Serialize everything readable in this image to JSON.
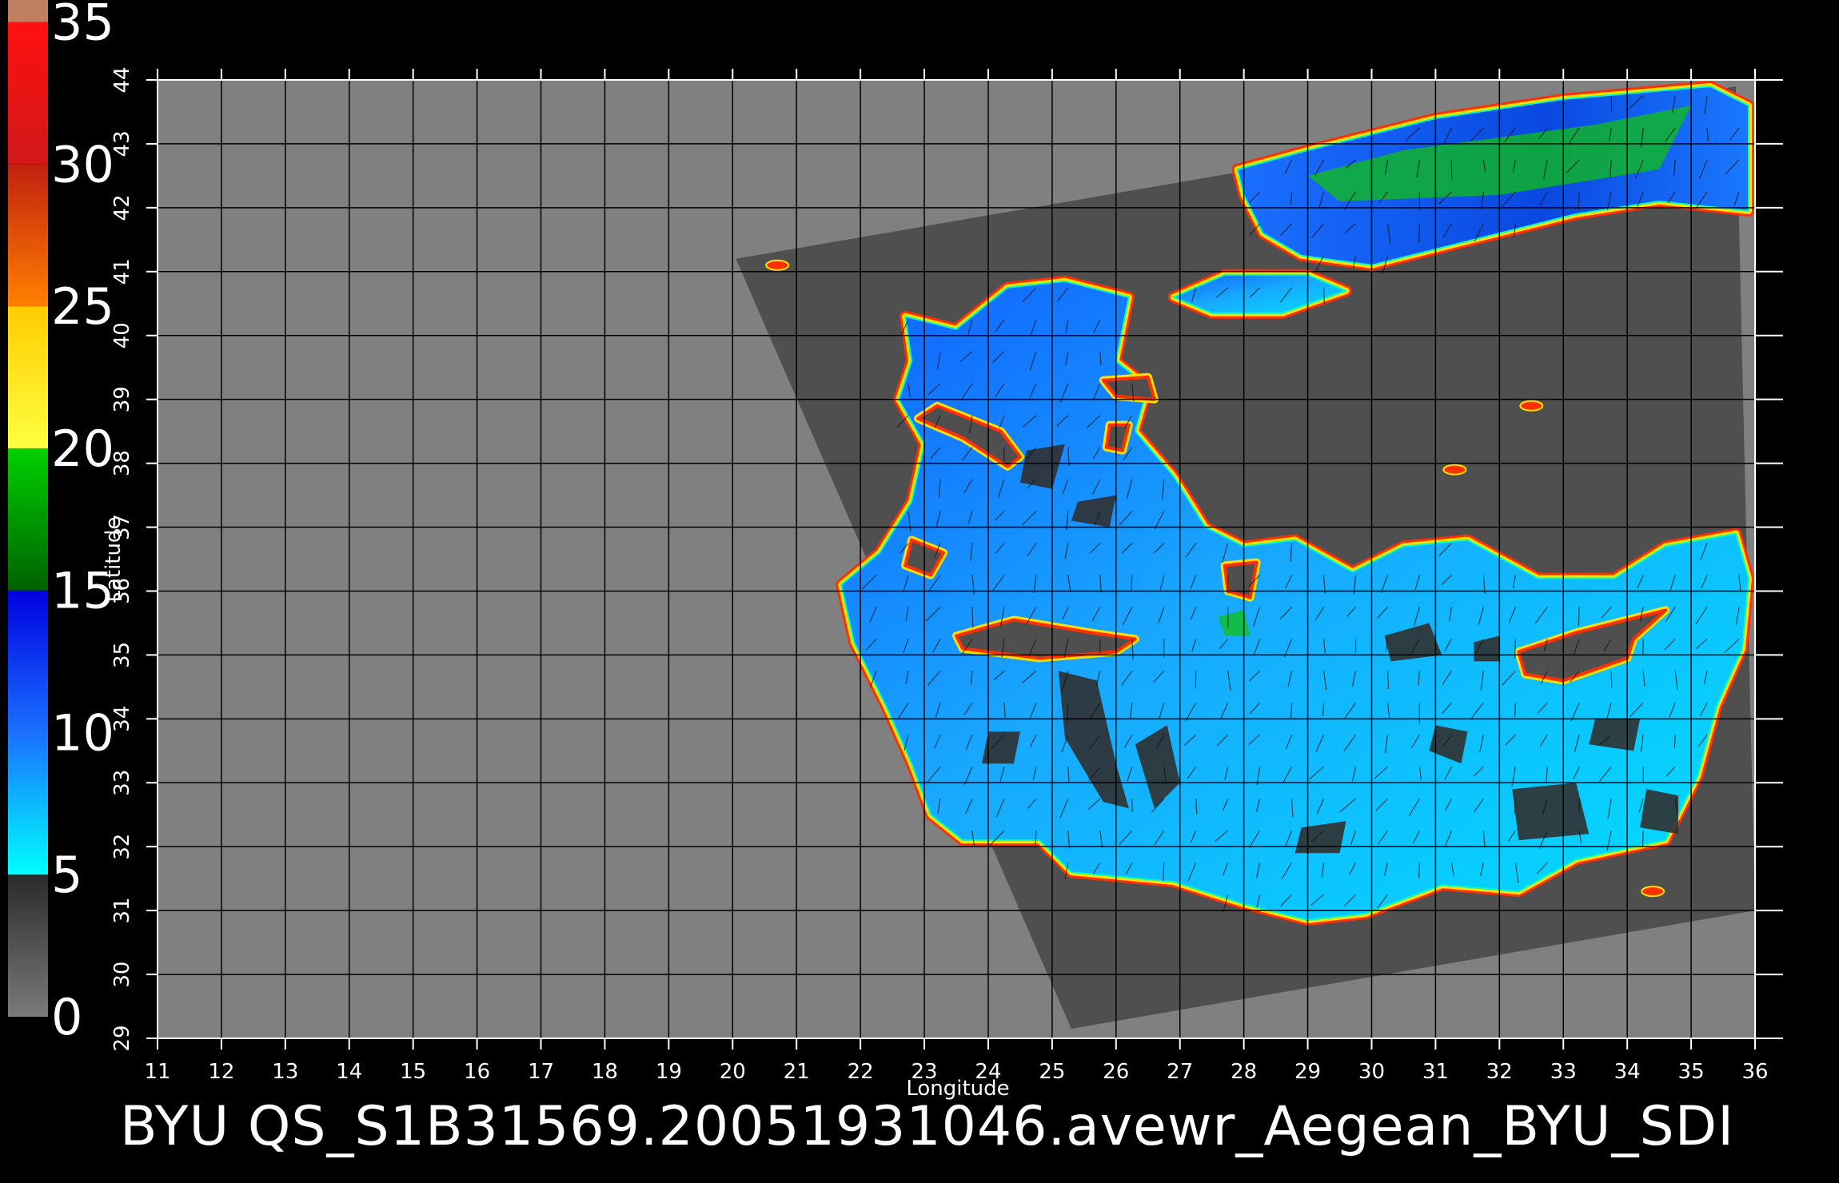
{
  "footer_caption": "BYU  QS_S1B31569.20051931046.avewr_Aegean_BYU_SDI",
  "colorbar": {
    "labels": [
      "0",
      "5",
      "10",
      "15",
      "20",
      "25",
      "30",
      "35"
    ],
    "segments": [
      {
        "from": 0,
        "to": 5,
        "color_top": "#2a2a2a",
        "color_bottom": "#7a7a7a"
      },
      {
        "from": 5,
        "to": 10,
        "color_top": "#1a70ff",
        "color_bottom": "#00ffff"
      },
      {
        "from": 10,
        "to": 15,
        "color_top": "#0000e0",
        "color_bottom": "#1a70ff"
      },
      {
        "from": 15,
        "to": 20,
        "color_top": "#00d000",
        "color_bottom": "#006000"
      },
      {
        "from": 20,
        "to": 25,
        "color_top": "#ffcc00",
        "color_bottom": "#ffff40"
      },
      {
        "from": 25,
        "to": 30,
        "color_top": "#c02010",
        "color_bottom": "#ff8000"
      },
      {
        "from": 30,
        "to": 35,
        "color_top": "#ff1010",
        "color_bottom": "#d01818"
      },
      {
        "from": 35,
        "to": 36,
        "color_top": "#c08060",
        "color_bottom": "#c08060"
      }
    ]
  },
  "map": {
    "x_axis_title": "Longitude",
    "y_axis_title": "Latitude",
    "lon_range": [
      11,
      36
    ],
    "lat_range": [
      29,
      44
    ],
    "lon_ticks": [
      "11",
      "12",
      "13",
      "14",
      "15",
      "16",
      "17",
      "18",
      "19",
      "20",
      "21",
      "22",
      "23",
      "24",
      "25",
      "26",
      "27",
      "28",
      "29",
      "30",
      "31",
      "32",
      "33",
      "34",
      "35",
      "36"
    ],
    "lat_ticks": [
      "29",
      "30",
      "31",
      "32",
      "33",
      "34",
      "35",
      "36",
      "37",
      "38",
      "39",
      "40",
      "41",
      "42",
      "43",
      "44"
    ],
    "colors": {
      "background": "#808080",
      "swath": "#4f4f4f",
      "grid": "#000000",
      "ocean_low": "#00e8ff",
      "ocean_mid": "#1a90ff",
      "ocean_high": "#0a40e8",
      "coast_edge": "#ff3000",
      "coast_yellow": "#ffe000",
      "calm_patch": "#303030",
      "strong_wind": "#10c010"
    },
    "swath_polygon_lonlat": [
      [
        20.05,
        41.2
      ],
      [
        35.7,
        43.9
      ],
      [
        36.0,
        31.0
      ],
      [
        25.3,
        29.15
      ]
    ],
    "water_regions_lonlat": [
      {
        "name": "black-sea",
        "points": [
          [
            27.9,
            42.6
          ],
          [
            29.0,
            42.9
          ],
          [
            31.0,
            43.4
          ],
          [
            33.0,
            43.7
          ],
          [
            35.3,
            43.9
          ],
          [
            35.9,
            43.6
          ],
          [
            35.9,
            41.95
          ],
          [
            34.5,
            42.1
          ],
          [
            33.2,
            41.9
          ],
          [
            31.6,
            41.5
          ],
          [
            30.0,
            41.1
          ],
          [
            28.9,
            41.25
          ],
          [
            28.3,
            41.6
          ],
          [
            28.0,
            42.2
          ]
        ],
        "strong": true
      },
      {
        "name": "sea-of-marmara",
        "points": [
          [
            26.9,
            40.6
          ],
          [
            27.7,
            40.95
          ],
          [
            29.0,
            40.95
          ],
          [
            29.6,
            40.7
          ],
          [
            28.6,
            40.35
          ],
          [
            27.5,
            40.35
          ]
        ],
        "strong": false
      },
      {
        "name": "aegean-mediterranean",
        "points": [
          [
            22.7,
            40.3
          ],
          [
            23.5,
            40.1
          ],
          [
            24.3,
            40.75
          ],
          [
            25.2,
            40.85
          ],
          [
            26.2,
            40.6
          ],
          [
            26.0,
            39.6
          ],
          [
            26.5,
            39.2
          ],
          [
            26.3,
            38.5
          ],
          [
            26.9,
            37.8
          ],
          [
            27.4,
            37.0
          ],
          [
            28.0,
            36.7
          ],
          [
            28.8,
            36.8
          ],
          [
            29.7,
            36.3
          ],
          [
            30.5,
            36.7
          ],
          [
            31.5,
            36.8
          ],
          [
            32.6,
            36.2
          ],
          [
            33.8,
            36.2
          ],
          [
            34.6,
            36.7
          ],
          [
            35.7,
            36.9
          ],
          [
            35.9,
            36.2
          ],
          [
            35.8,
            35.1
          ],
          [
            35.4,
            34.2
          ],
          [
            35.1,
            33.1
          ],
          [
            34.6,
            32.1
          ],
          [
            33.2,
            31.8
          ],
          [
            32.3,
            31.3
          ],
          [
            31.1,
            31.4
          ],
          [
            29.9,
            30.95
          ],
          [
            29.0,
            30.85
          ],
          [
            28.0,
            31.1
          ],
          [
            26.9,
            31.45
          ],
          [
            25.3,
            31.6
          ],
          [
            24.8,
            32.1
          ],
          [
            23.6,
            32.1
          ],
          [
            23.1,
            32.5
          ],
          [
            22.8,
            33.3
          ],
          [
            22.4,
            34.2
          ],
          [
            21.9,
            35.2
          ],
          [
            21.7,
            36.1
          ],
          [
            22.3,
            36.6
          ],
          [
            22.8,
            37.4
          ],
          [
            23.0,
            38.3
          ],
          [
            22.6,
            39.0
          ],
          [
            22.8,
            39.6
          ]
        ],
        "strong": false
      }
    ],
    "land_islands_lonlat": [
      {
        "name": "crete",
        "points": [
          [
            23.5,
            35.3
          ],
          [
            24.4,
            35.55
          ],
          [
            25.6,
            35.35
          ],
          [
            26.3,
            35.25
          ],
          [
            26.0,
            35.05
          ],
          [
            24.8,
            34.95
          ],
          [
            23.6,
            35.1
          ]
        ]
      },
      {
        "name": "cyprus",
        "points": [
          [
            32.3,
            35.05
          ],
          [
            33.2,
            35.35
          ],
          [
            34.6,
            35.7
          ],
          [
            34.1,
            35.25
          ],
          [
            34.0,
            34.95
          ],
          [
            33.0,
            34.6
          ],
          [
            32.4,
            34.7
          ]
        ]
      },
      {
        "name": "euboea",
        "points": [
          [
            23.2,
            38.9
          ],
          [
            24.2,
            38.5
          ],
          [
            24.5,
            38.1
          ],
          [
            24.3,
            37.95
          ],
          [
            23.6,
            38.4
          ],
          [
            22.9,
            38.7
          ]
        ]
      },
      {
        "name": "lesbos",
        "points": [
          [
            25.8,
            39.3
          ],
          [
            26.5,
            39.35
          ],
          [
            26.6,
            39.0
          ],
          [
            26.0,
            39.05
          ]
        ]
      },
      {
        "name": "chios",
        "points": [
          [
            25.9,
            38.6
          ],
          [
            26.2,
            38.6
          ],
          [
            26.1,
            38.2
          ],
          [
            25.85,
            38.25
          ]
        ]
      },
      {
        "name": "rhodes",
        "points": [
          [
            27.7,
            36.4
          ],
          [
            28.2,
            36.45
          ],
          [
            28.1,
            35.9
          ],
          [
            27.75,
            36.0
          ]
        ]
      },
      {
        "name": "kythira-peloponnese-tip",
        "points": [
          [
            22.8,
            36.8
          ],
          [
            23.3,
            36.6
          ],
          [
            23.1,
            36.25
          ],
          [
            22.7,
            36.4
          ]
        ]
      }
    ],
    "calm_patches_lonlat": [
      [
        [
          25.1,
          34.75
        ],
        [
          25.7,
          34.6
        ],
        [
          26.0,
          33.3
        ],
        [
          26.2,
          32.6
        ],
        [
          25.8,
          32.7
        ],
        [
          25.2,
          33.7
        ]
      ],
      [
        [
          26.3,
          33.6
        ],
        [
          26.8,
          33.9
        ],
        [
          27.0,
          33.0
        ],
        [
          26.6,
          32.6
        ]
      ],
      [
        [
          24.0,
          33.8
        ],
        [
          24.5,
          33.8
        ],
        [
          24.4,
          33.3
        ],
        [
          23.9,
          33.3
        ]
      ],
      [
        [
          28.9,
          32.3
        ],
        [
          29.6,
          32.4
        ],
        [
          29.5,
          31.9
        ],
        [
          28.8,
          31.9
        ]
      ],
      [
        [
          31.0,
          33.9
        ],
        [
          31.5,
          33.8
        ],
        [
          31.4,
          33.3
        ],
        [
          30.9,
          33.5
        ]
      ],
      [
        [
          32.2,
          32.9
        ],
        [
          33.2,
          33.0
        ],
        [
          33.4,
          32.2
        ],
        [
          32.3,
          32.1
        ]
      ],
      [
        [
          34.3,
          32.9
        ],
        [
          34.8,
          32.8
        ],
        [
          34.8,
          32.2
        ],
        [
          34.2,
          32.3
        ]
      ],
      [
        [
          30.2,
          35.3
        ],
        [
          30.9,
          35.5
        ],
        [
          31.1,
          35.0
        ],
        [
          30.3,
          34.9
        ]
      ],
      [
        [
          33.5,
          34.0
        ],
        [
          34.2,
          34.0
        ],
        [
          34.1,
          33.5
        ],
        [
          33.4,
          33.6
        ]
      ],
      [
        [
          31.6,
          35.2
        ],
        [
          32.0,
          35.3
        ],
        [
          32.0,
          34.9
        ],
        [
          31.6,
          34.9
        ]
      ],
      [
        [
          24.6,
          38.2
        ],
        [
          25.2,
          38.3
        ],
        [
          25.0,
          37.6
        ],
        [
          24.5,
          37.7
        ]
      ],
      [
        [
          25.4,
          37.4
        ],
        [
          26.0,
          37.5
        ],
        [
          25.9,
          37.0
        ],
        [
          25.3,
          37.1
        ]
      ]
    ],
    "strong_patches_lonlat": [
      [
        [
          29.0,
          42.5
        ],
        [
          30.5,
          42.9
        ],
        [
          33.5,
          43.3
        ],
        [
          35.0,
          43.6
        ],
        [
          34.5,
          42.6
        ],
        [
          32.0,
          42.2
        ],
        [
          29.5,
          42.1
        ]
      ],
      [
        [
          27.6,
          35.6
        ],
        [
          28.0,
          35.7
        ],
        [
          28.1,
          35.3
        ],
        [
          27.7,
          35.3
        ]
      ]
    ],
    "coast_markers_lonlat": [
      [
        32.5,
        38.9
      ],
      [
        20.7,
        41.1
      ],
      [
        34.4,
        31.3
      ],
      [
        31.3,
        37.9
      ]
    ],
    "wind_field": {
      "base_direction_deg": 250,
      "spacing_deg": 0.5
    }
  }
}
